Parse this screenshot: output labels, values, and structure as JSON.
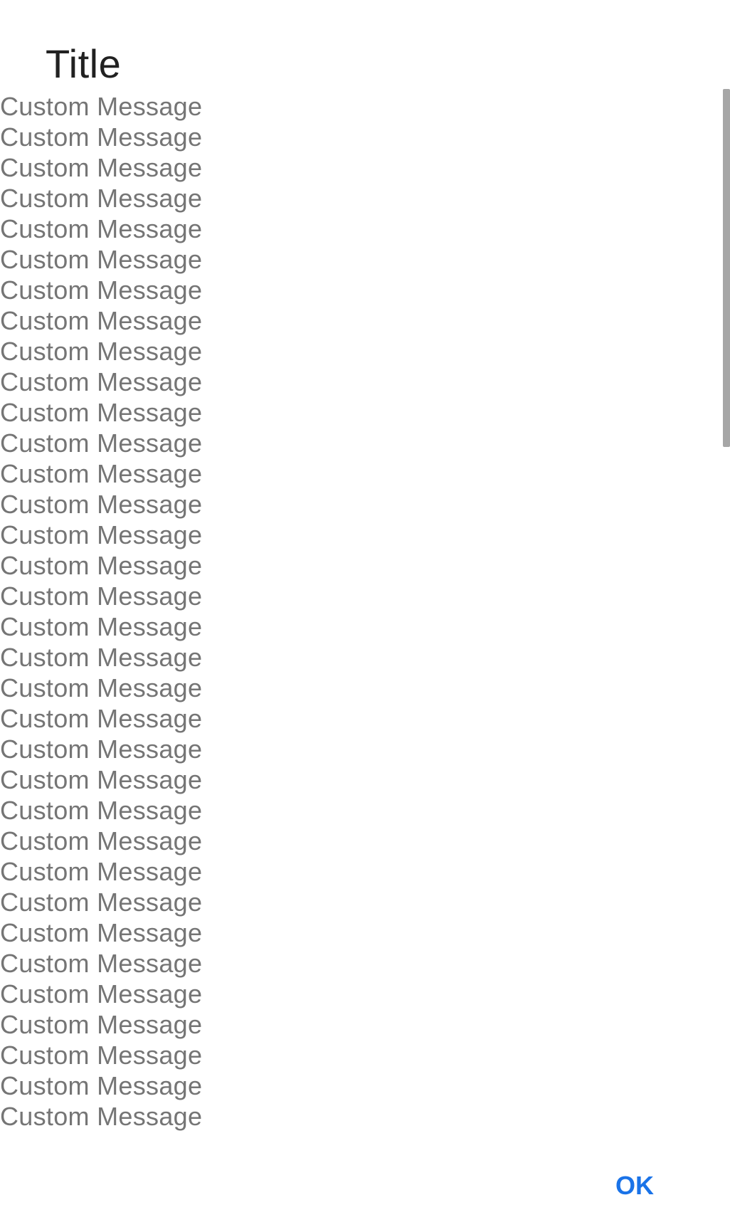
{
  "dialog": {
    "title": "Title",
    "messages": [
      "Custom Message",
      "Custom Message",
      "Custom Message",
      "Custom Message",
      "Custom Message",
      "Custom Message",
      "Custom Message",
      "Custom Message",
      "Custom Message",
      "Custom Message",
      "Custom Message",
      "Custom Message",
      "Custom Message",
      "Custom Message",
      "Custom Message",
      "Custom Message",
      "Custom Message",
      "Custom Message",
      "Custom Message",
      "Custom Message",
      "Custom Message",
      "Custom Message",
      "Custom Message",
      "Custom Message",
      "Custom Message",
      "Custom Message",
      "Custom Message",
      "Custom Message",
      "Custom Message",
      "Custom Message",
      "Custom Message",
      "Custom Message",
      "Custom Message",
      "Custom Message"
    ],
    "ok_label": "OK"
  },
  "colors": {
    "title": "#212121",
    "message": "#757575",
    "accent": "#1a73e8",
    "scrollbar": "#a6a6a6"
  }
}
